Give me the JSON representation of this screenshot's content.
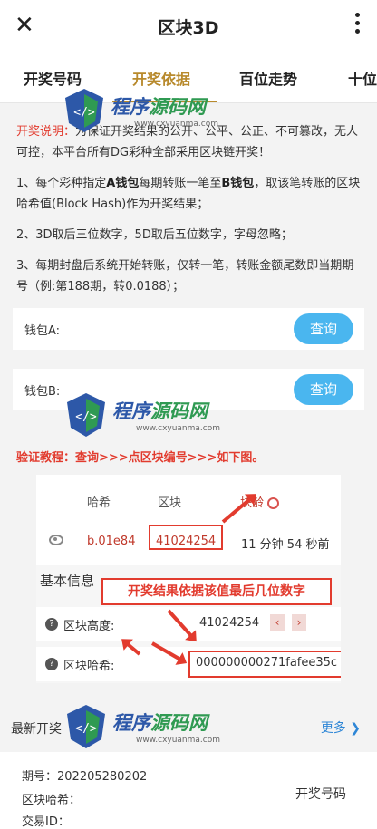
{
  "header": {
    "title": "区块3D",
    "close_icon": "close-icon",
    "more_icon": "more-vertical-icon"
  },
  "tabs": [
    {
      "label": "开奖号码"
    },
    {
      "label": "开奖依据"
    },
    {
      "label": "百位走势"
    },
    {
      "label": "十位"
    }
  ],
  "active_tab": "开奖依据",
  "explain": {
    "intro_label": "开奖说明：",
    "intro_text": "为保证开奖结果的公开、公平、公正、不可篡改，无人可控，本平台所有DG彩种全部采用区块链开奖！",
    "rule1_a": "1、每个彩种指定",
    "rule1_b": "A钱包",
    "rule1_c": "每期转账一笔至",
    "rule1_d": "B钱包",
    "rule1_e": "，取该笔转账的区块哈希值(Block Hash)作为开奖结果；",
    "rule2": "2、3D取后三位数字，5D取后五位数字，字母忽略；",
    "rule3": "3、每期封盘后系统开始转账，仅转一笔，转账金额尾数即当期期号（例:第188期，转0.0188）；"
  },
  "wallets": [
    {
      "label": "钱包A:",
      "button": "查询"
    },
    {
      "label": "钱包B:",
      "button": "查询"
    }
  ],
  "verify": "验证教程：查询>>>点区块编号>>>如下图。",
  "demo": {
    "col_hash": "哈希",
    "col_block": "区块",
    "col_age": "块龄",
    "hash": "b.01e84",
    "block": "41024254",
    "age": "11 分钟 54 秒前",
    "basic_info": "基本信息",
    "note": "开奖结果依据该值最后几位数字",
    "height_label": "区块高度:",
    "height_value": "41024254",
    "hash_label": "区块哈希:",
    "hash_value": "000000000271fafee35c"
  },
  "latest": {
    "title": "最新开奖",
    "more": "更多 ❯"
  },
  "result": {
    "issue": "期号：202205280202",
    "block_hash": "区块哈希：",
    "tx_id": "交易ID：",
    "result_label": "开奖号码"
  },
  "watermark": {
    "name_a": "程序",
    "name_b": "源码网",
    "url": "www.cxyuanma.com"
  },
  "colors": {
    "accent": "#b88a2d",
    "button": "#4ab6ef",
    "highlight": "#e23b2e",
    "link": "#2e86d6"
  }
}
